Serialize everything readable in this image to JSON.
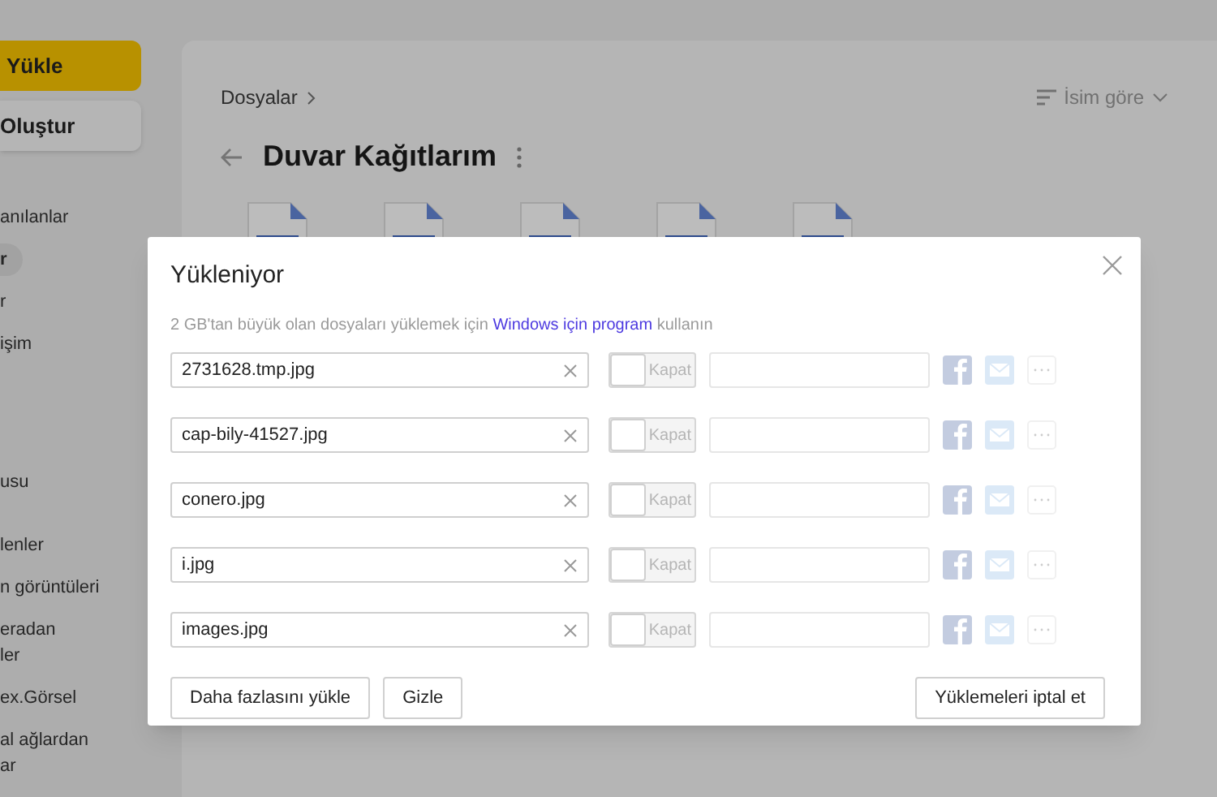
{
  "sidebar": {
    "upload_button": "Yükle",
    "create_button": "Oluştur",
    "groups": [
      {
        "items": [
          {
            "label": "anılanlar",
            "selected": false
          },
          {
            "label": "r",
            "selected": true
          },
          {
            "label": "r",
            "selected": false
          },
          {
            "label": "işim",
            "selected": false
          }
        ]
      },
      {
        "items": [
          {
            "label": "usu",
            "selected": false
          }
        ]
      },
      {
        "items": [
          {
            "label": "lenler",
            "selected": false
          },
          {
            "label": "n görüntüleri",
            "selected": false
          },
          {
            "label": "eradan\nler",
            "selected": false
          },
          {
            "label": "ex.Görsel",
            "selected": false
          },
          {
            "label": "al ağlardan\nar",
            "selected": false
          }
        ]
      }
    ]
  },
  "main": {
    "breadcrumb": [
      "Dosyalar"
    ],
    "sort": "İsim göre",
    "title": "Duvar Kağıtlarım",
    "files": [
      {
        "kind": "picture"
      },
      {
        "kind": "picture"
      },
      {
        "kind": "picture"
      },
      {
        "kind": "picture"
      },
      {
        "kind": "picture"
      }
    ]
  },
  "dialog": {
    "title": "Yükleniyor",
    "hint_before": "2 GB'tan büyük olan dosyaları yüklemek için",
    "hint_link": "Windows için program",
    "hint_after": "kullanın",
    "uploads": [
      {
        "name": "2731628.tmp.jpg",
        "toggle": {
          "label": "Kapat",
          "on": false
        }
      },
      {
        "name": "cap-bily-41527.jpg",
        "toggle": {
          "label": "Kapat",
          "on": false
        }
      },
      {
        "name": "conero.jpg",
        "toggle": {
          "label": "Kapat",
          "on": false
        }
      },
      {
        "name": "i.jpg",
        "toggle": {
          "label": "Kapat",
          "on": false
        }
      },
      {
        "name": "images.jpg",
        "toggle": {
          "label": "Kapat",
          "on": false
        }
      }
    ],
    "buttons": [
      "Daha fazlasını yükle",
      "Gizle"
    ],
    "cancel_button": "Yüklemeleri iptal et"
  }
}
